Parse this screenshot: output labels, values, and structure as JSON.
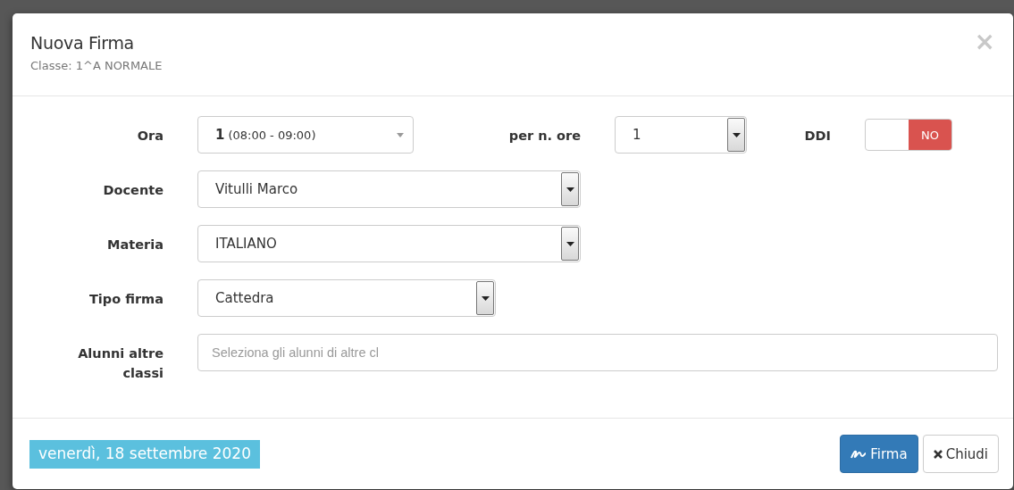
{
  "dialog": {
    "title": "Nuova Firma",
    "subtitle": "Classe: 1^A NORMALE",
    "close": "×"
  },
  "first_row": {
    "ora": {
      "label": "Ora",
      "value": "1",
      "detail": "(08:00 - 09:00)",
      "kind": "select2"
    },
    "ore": {
      "label": "per n. ore",
      "value": "1",
      "kind": "native"
    },
    "ddi": {
      "label": "DDI",
      "on": false,
      "state_text": "NO"
    }
  },
  "fields": [
    {
      "label": "Docente",
      "value": "Vitulli Marco",
      "kind": "native"
    },
    {
      "label": "Materia",
      "value": "ITALIANO",
      "kind": "native"
    },
    {
      "label": "Tipo firma",
      "value": "Cattedra",
      "kind": "native"
    },
    {
      "label": "Alunni altre classi",
      "placeholder": "Seleziona gli alunni di altre cl",
      "kind": "text"
    }
  ],
  "footer": {
    "date": "venerdì, 18 settembre 2020",
    "buttons": [
      {
        "label": "Firma",
        "kind": "primary"
      },
      {
        "label": "Chiudi",
        "kind": "default"
      }
    ]
  }
}
